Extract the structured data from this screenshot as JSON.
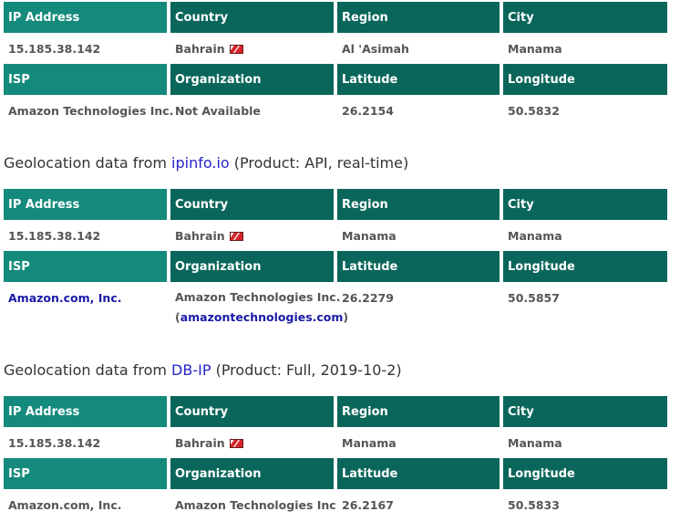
{
  "blocks": [
    {
      "caption": null,
      "table": {
        "header1": [
          "IP Address",
          "Country",
          "Region",
          "City"
        ],
        "row1": {
          "ip": "15.185.38.142",
          "country": "Bahrain",
          "region": "Al 'Asimah",
          "city": "Manama"
        },
        "header2": [
          "ISP",
          "Organization",
          "Latitude",
          "Longitude"
        ],
        "row2": {
          "isp": "Amazon Technologies Inc.",
          "organization": "Not Available",
          "latitude": "26.2154",
          "longitude": "50.5832"
        }
      }
    },
    {
      "caption": {
        "prefix": "Geolocation data from ",
        "link": "ipinfo.io",
        "suffix": " (Product: API, real-time)"
      },
      "table": {
        "header1": [
          "IP Address",
          "Country",
          "Region",
          "City"
        ],
        "row1": {
          "ip": "15.185.38.142",
          "country": "Bahrain",
          "region": "Manama",
          "city": "Manama"
        },
        "header2": [
          "ISP",
          "Organization",
          "Latitude",
          "Longitude"
        ],
        "row2": {
          "isp": "Amazon.com, Inc.",
          "organization_line1": "Amazon Technologies Inc.",
          "organization_open": "(",
          "organization_link": "amazontechnologies.com",
          "organization_close": ")",
          "latitude": "26.2279",
          "longitude": "50.5857"
        }
      }
    },
    {
      "caption": {
        "prefix": "Geolocation data from ",
        "link": "DB-IP",
        "suffix": " (Product: Full, 2019-10-2)"
      },
      "table": {
        "header1": [
          "IP Address",
          "Country",
          "Region",
          "City"
        ],
        "row1": {
          "ip": "15.185.38.142",
          "country": "Bahrain",
          "region": "Manama",
          "city": "Manama"
        },
        "header2": [
          "ISP",
          "Organization",
          "Latitude",
          "Longitude"
        ],
        "row2": {
          "isp": "Amazon.com, Inc.",
          "organization": "Amazon Technologies Inc",
          "latitude": "26.2167",
          "longitude": "50.5833"
        }
      }
    }
  ],
  "colors": {
    "header_light": "#148a7c",
    "header_dark": "#0a665b",
    "link": "#1a1aa8",
    "flag_red": "#d4242a"
  },
  "icons": {
    "country_flag": "bahrain-flag-icon"
  }
}
